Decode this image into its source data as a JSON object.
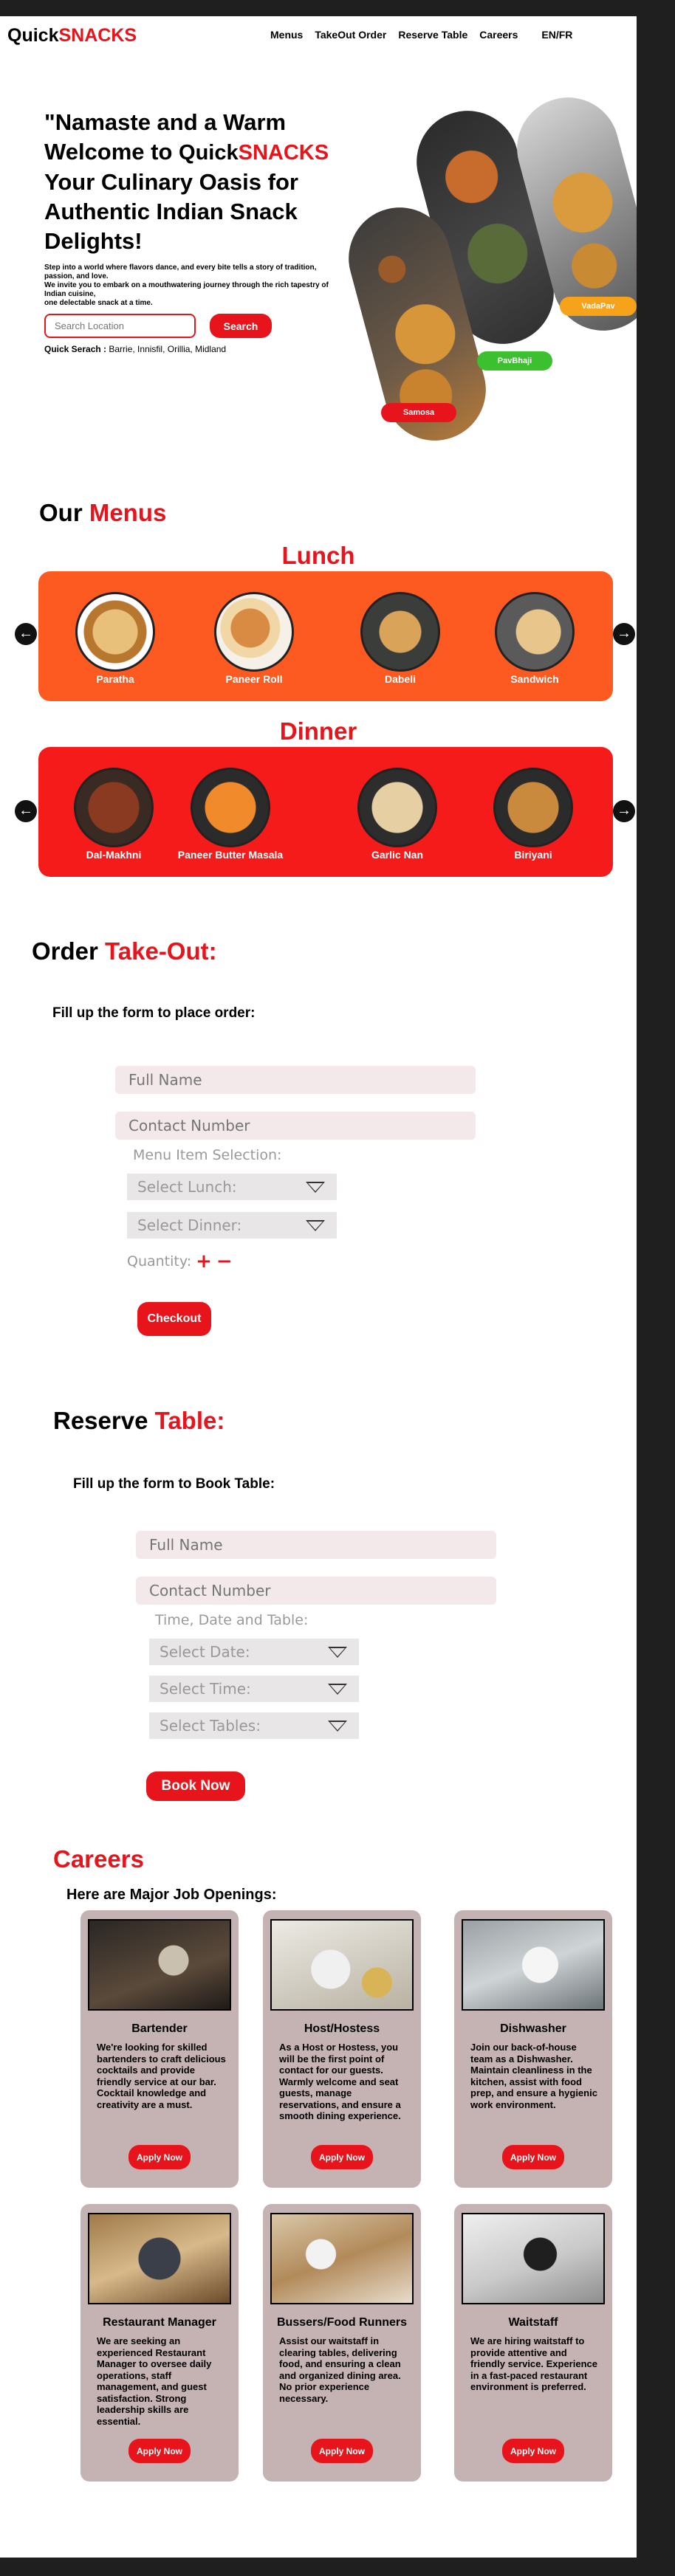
{
  "nav": {
    "logo_a": "Quick",
    "logo_b": "SNACKS",
    "links": [
      "Menus",
      "TakeOut Order",
      "Reserve Table",
      "Careers"
    ],
    "lang": "EN/FR"
  },
  "hero": {
    "title_a": "\"Namaste and a Warm Welcome to ",
    "brand_a": "Quick",
    "brand_b": "SNACKS",
    "title_b": " Your Culinary Oasis for Authentic Indian Snack Delights!",
    "desc_1": "Step into a world where flavors dance, and every bite tells a story of tradition, passion, and love.",
    "desc_2": "We invite you to embark on a mouthwatering journey through the rich tapestry of Indian cuisine,",
    "desc_3": "one delectable snack at a time.",
    "search_placeholder": "Search Location",
    "search_button": "Search",
    "quick_search_label": "Quick Serach :",
    "quick_search_places": " Barrie, Innisfil, Orillia, Midland",
    "tags": [
      "Samosa",
      "PavBhaji",
      "VadaPav"
    ]
  },
  "menus": {
    "title_a": "Our ",
    "title_b": "Menus",
    "lunch_title": "Lunch",
    "dinner_title": "Dinner",
    "lunch_items": [
      "Paratha",
      "Paneer Roll",
      "Dabeli",
      "Sandwich"
    ],
    "dinner_items": [
      "Dal-Makhni",
      "Paneer Butter Masala",
      "Garlic Nan",
      "Biriyani"
    ],
    "arrow_left": "←",
    "arrow_right": "→"
  },
  "order": {
    "title_a": "Order ",
    "title_b": "Take-Out:",
    "caption": "Fill up the form to place order:",
    "name_placeholder": "Full Name",
    "contact_placeholder": "Contact Number",
    "menu_label": "Menu Item Selection:",
    "select_lunch": "Select Lunch:",
    "select_dinner": "Select Dinner:",
    "quantity_label": "Quantity:",
    "plus": "+",
    "minus": "−",
    "checkout": "Checkout"
  },
  "reserve": {
    "title_a": "Reserve ",
    "title_b": "Table:",
    "caption": "Fill up the form to Book Table:",
    "name_placeholder": "Full Name",
    "contact_placeholder": "Contact Number",
    "time_label": "Time, Date and Table:",
    "select_date": "Select Date:",
    "select_time": "Select Time:",
    "select_tables": "Select Tables:",
    "book_now": "Book Now"
  },
  "careers": {
    "title": "Careers",
    "subtitle": "Here are Major Job Openings:",
    "apply_label": "Apply Now",
    "jobs": [
      {
        "name": "Bartender",
        "desc": "We're looking for skilled bartenders to craft delicious cocktails and provide friendly service at our bar. Cocktail knowledge and creativity are a must."
      },
      {
        "name": "Host/Hostess",
        "desc": "As a Host or Hostess, you will be the first point of contact for our guests. Warmly welcome and seat guests, manage reservations, and ensure a smooth dining experience."
      },
      {
        "name": "Dishwasher",
        "desc": "Join our back-of-house team as a Dishwasher. Maintain cleanliness in the kitchen, assist with food prep, and ensure a hygienic work environment."
      },
      {
        "name": "Restaurant Manager",
        "desc": "We are seeking an experienced Restaurant Manager to oversee daily operations, staff management, and guest satisfaction. Strong leadership skills are essential."
      },
      {
        "name": "Bussers/Food Runners",
        "desc": "Assist our waitstaff in clearing tables, delivering food, and ensuring a clean and organized dining area. No prior experience necessary."
      },
      {
        "name": "Waitstaff",
        "desc": "We are hiring waitstaff to provide attentive and friendly service. Experience in a fast-paced restaurant environment is preferred."
      }
    ]
  },
  "colors": {
    "brand_red": "#e8141b",
    "lunch_band": "#fd5a21",
    "dinner_band": "#f51b1b",
    "card_bg": "#c5b3b3",
    "pavbhaji_tag": "#3cc02f",
    "vadapav_tag": "#f6a21a"
  }
}
